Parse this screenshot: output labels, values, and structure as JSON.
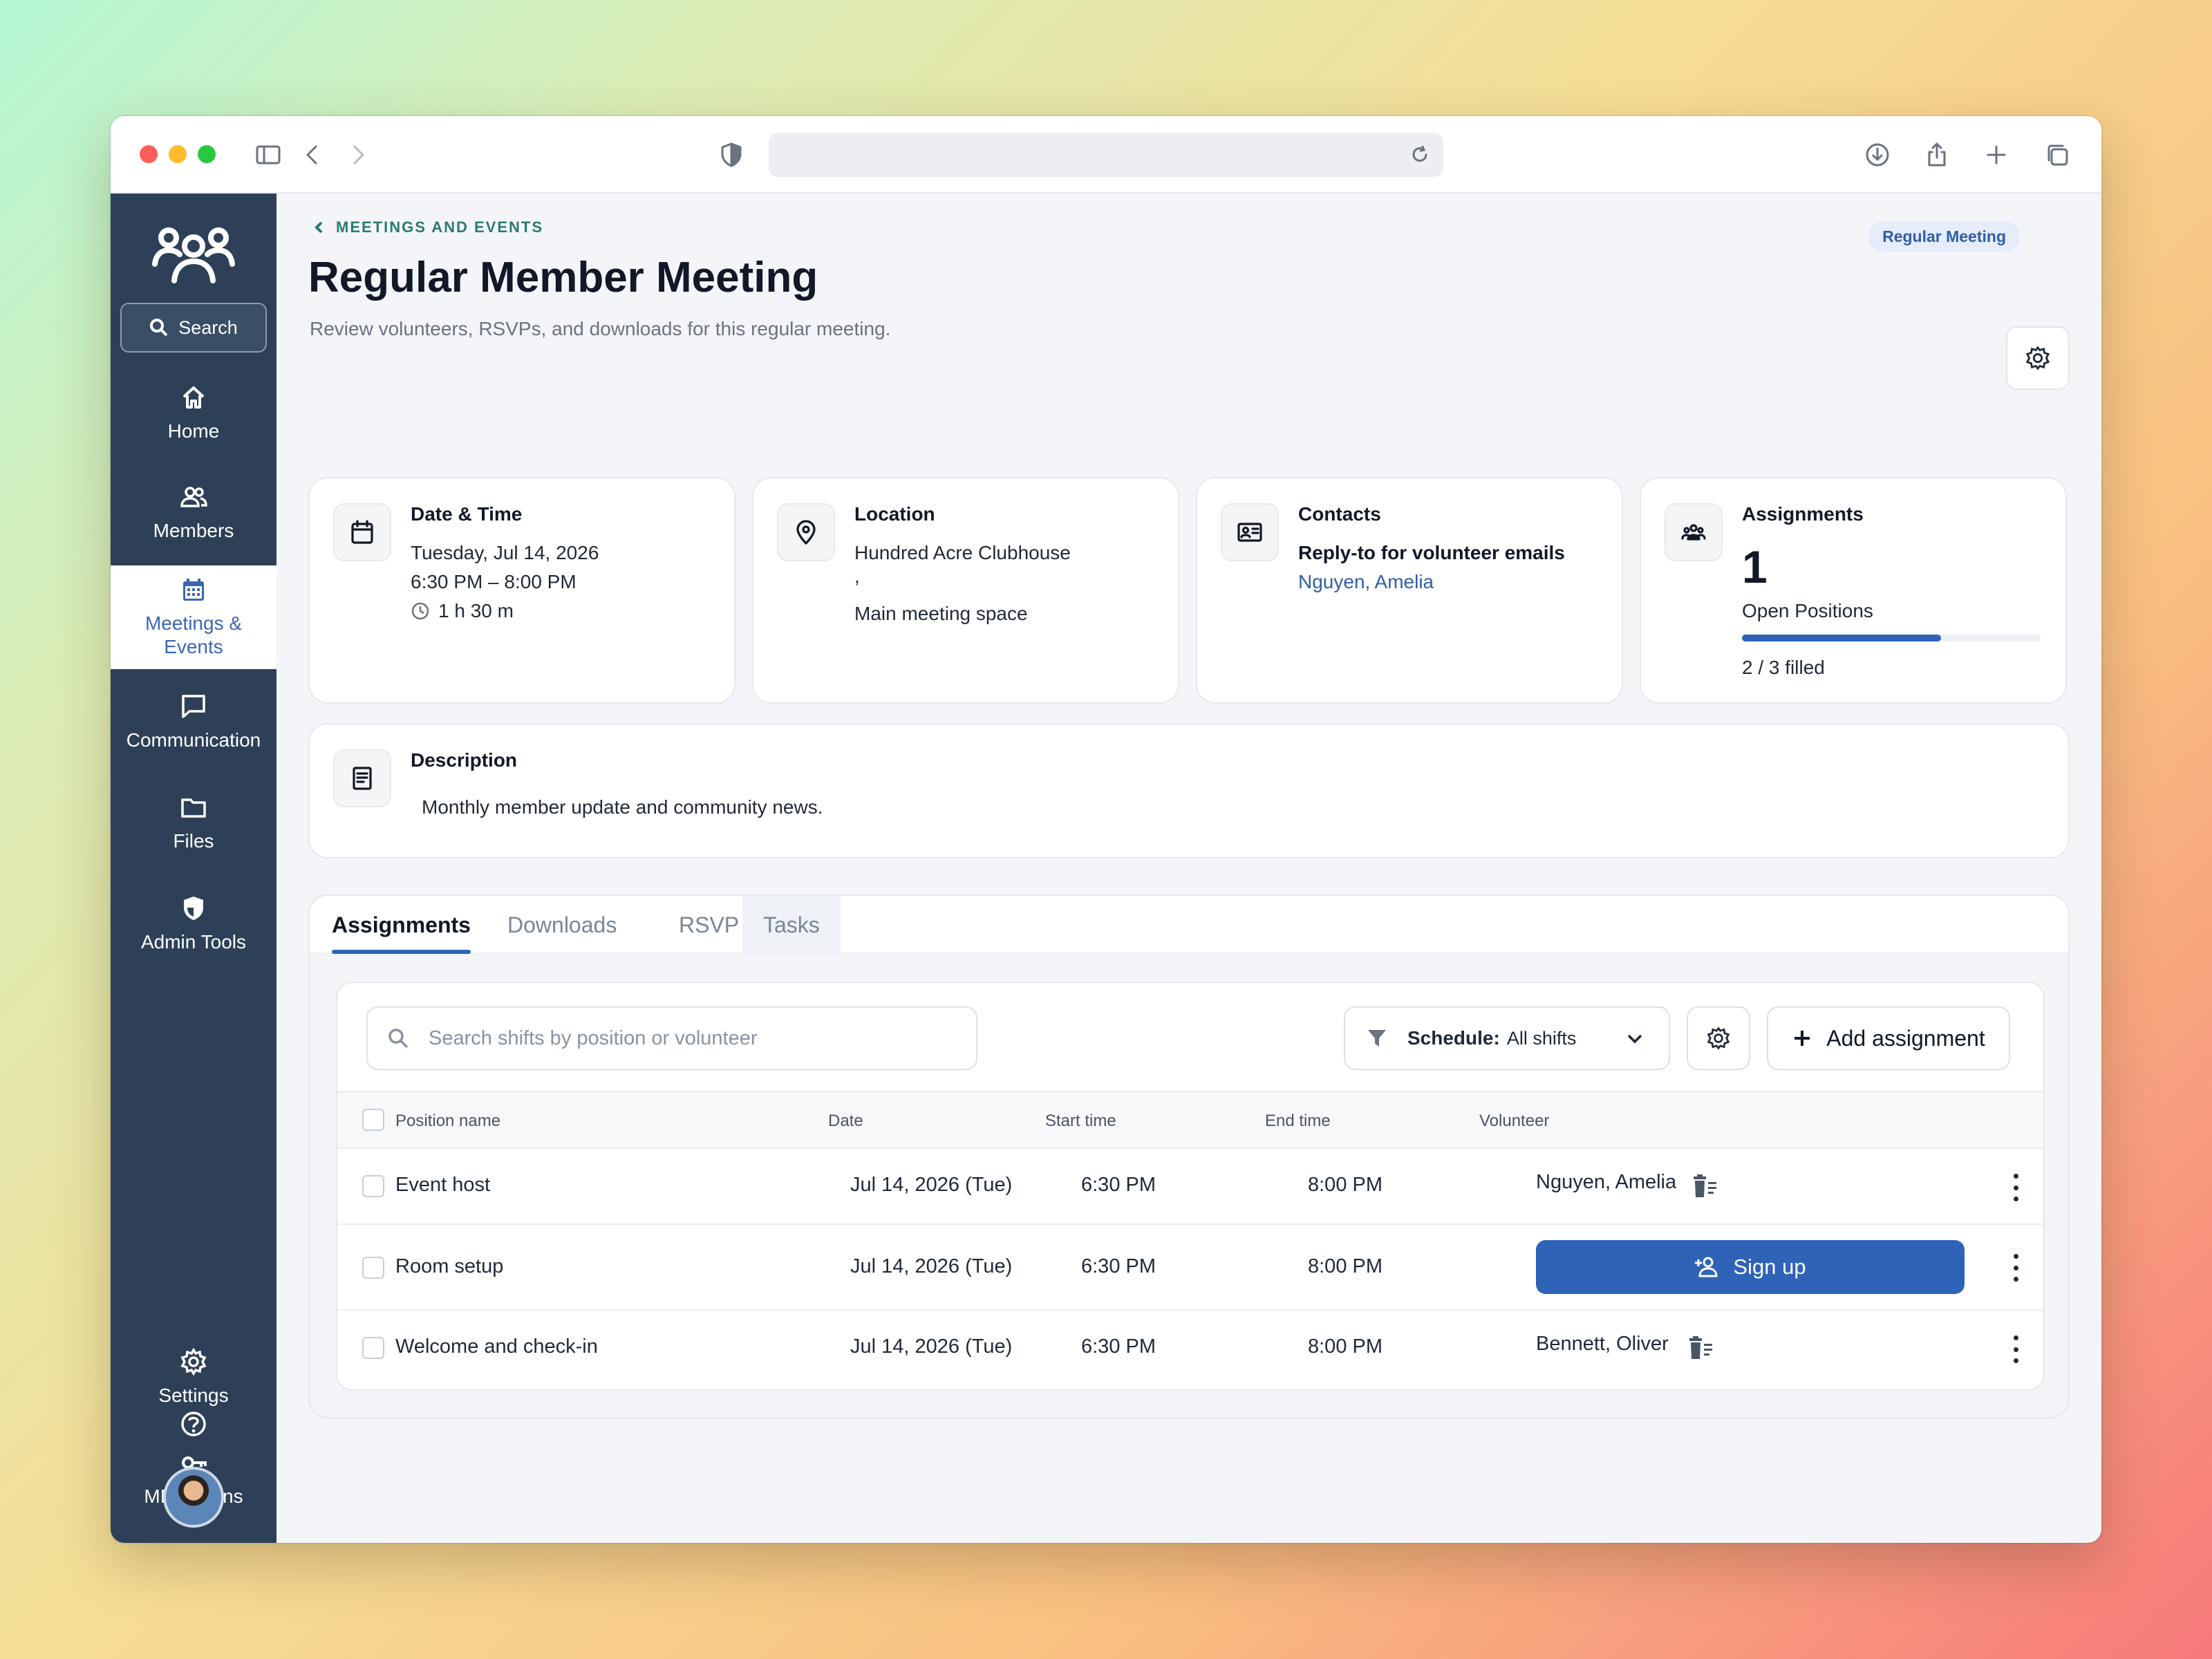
{
  "sidebar": {
    "search_label": "Search",
    "items": [
      {
        "label": "Home",
        "icon": "home-icon"
      },
      {
        "label": "Members",
        "icon": "members-icon"
      },
      {
        "label": "Meetings & Events",
        "icon": "calendar-icon",
        "active": true
      },
      {
        "label": "Communication",
        "icon": "chat-icon"
      },
      {
        "label": "Files",
        "icon": "folder-icon"
      },
      {
        "label": "Admin Tools",
        "icon": "shield-icon"
      },
      {
        "label": "Settings",
        "icon": "gear-icon"
      },
      {
        "label": "MD Admins",
        "icon": "key-icon"
      }
    ],
    "help_icon": "help-icon"
  },
  "header": {
    "breadcrumb": "MEETINGS AND EVENTS",
    "title": "Regular Member Meeting",
    "subtitle": "Review volunteers, RSVPs, and downloads for this regular meeting.",
    "badge": "Regular Meeting"
  },
  "cards": {
    "datetime": {
      "title": "Date & Time",
      "date": "Tuesday, Jul 14, 2026",
      "time": "6:30 PM – 8:00 PM",
      "duration": "1 h 30 m"
    },
    "location": {
      "title": "Location",
      "line1": "Hundred Acre Clubhouse",
      "line2": ",",
      "line3": "Main meeting space"
    },
    "contacts": {
      "title": "Contacts",
      "role": "Reply-to for volunteer emails",
      "name": "Nguyen, Amelia"
    },
    "assignments": {
      "title": "Assignments",
      "count": "1",
      "count_label": "Open Positions",
      "filled_text": "2 / 3 filled",
      "filled_fraction": 0.667
    }
  },
  "description": {
    "title": "Description",
    "text": "Monthly member update and community news."
  },
  "tabs": [
    {
      "label": "Assignments",
      "active": true
    },
    {
      "label": "Downloads"
    },
    {
      "label": "RSVP"
    },
    {
      "label": "Tasks"
    }
  ],
  "toolbar": {
    "search_placeholder": "Search shifts by position or volunteer",
    "schedule_label": "Schedule:",
    "schedule_value": "All shifts",
    "add_label": "Add assignment"
  },
  "table": {
    "columns": [
      "Position name",
      "Date",
      "Start time",
      "End time",
      "Volunteer"
    ],
    "rows": [
      {
        "position": "Event host",
        "date": "Jul 14, 2026 (Tue)",
        "start": "6:30 PM",
        "end": "8:00 PM",
        "volunteer": "Nguyen, Amelia"
      },
      {
        "position": "Room setup",
        "date": "Jul 14, 2026 (Tue)",
        "start": "6:30 PM",
        "end": "8:00 PM",
        "volunteer": "",
        "action": "Sign up"
      },
      {
        "position": "Welcome and check-in",
        "date": "Jul 14, 2026 (Tue)",
        "start": "6:30 PM",
        "end": "8:00 PM",
        "volunteer": "Bennett, Oliver"
      }
    ]
  },
  "colors": {
    "sidebar": "#2d4058",
    "accent": "#2e63b8",
    "breadcrumb": "#2c7a6e"
  }
}
